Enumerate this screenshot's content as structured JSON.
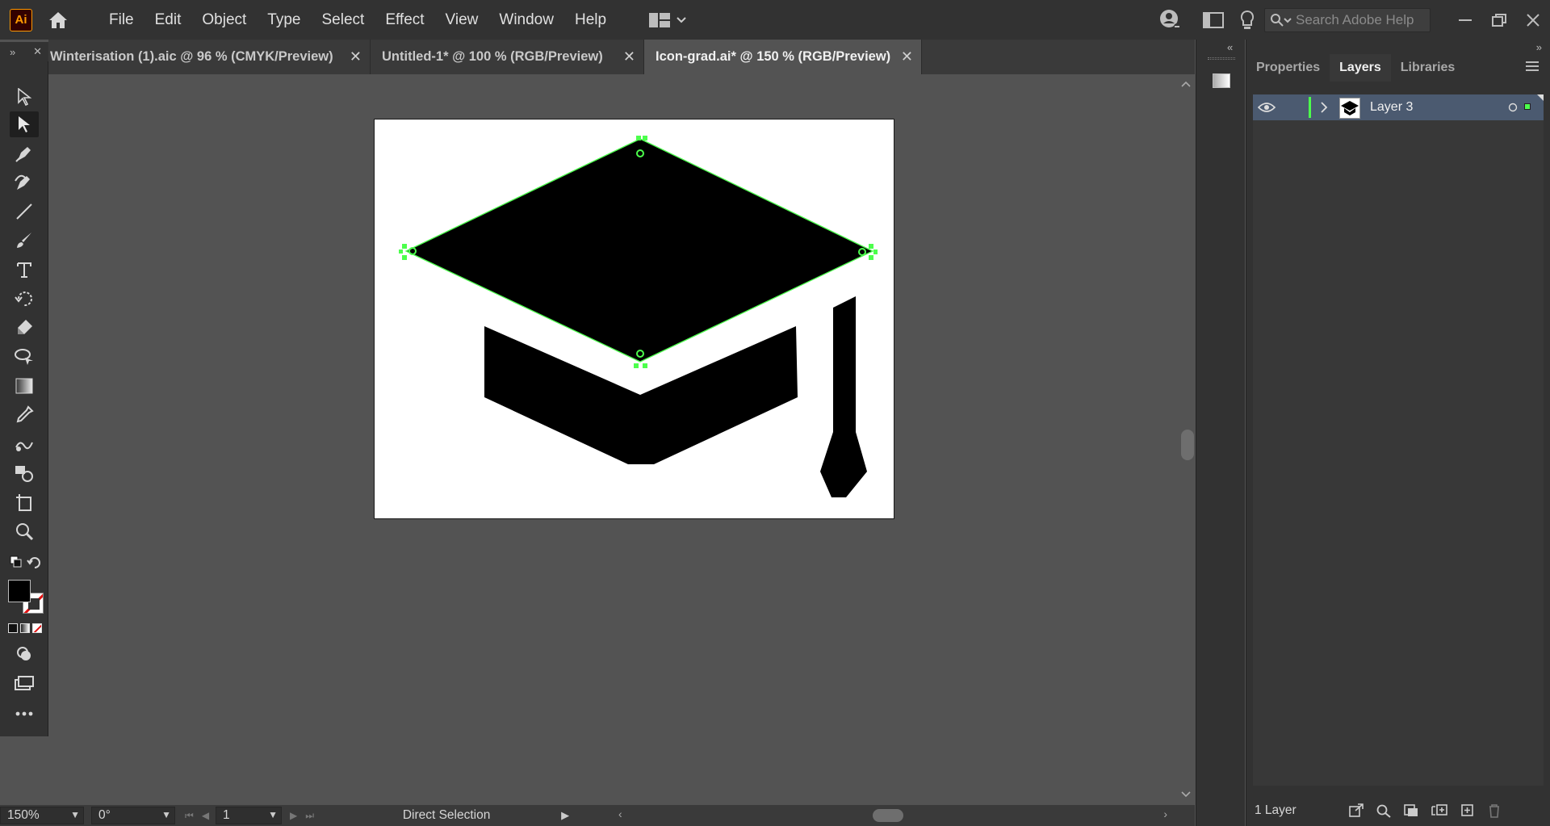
{
  "app": {
    "logo_text": "Ai"
  },
  "menu": [
    "File",
    "Edit",
    "Object",
    "Type",
    "Select",
    "Effect",
    "View",
    "Window",
    "Help"
  ],
  "search": {
    "placeholder": "Search Adobe Help"
  },
  "tabs": [
    {
      "label": "Winterisation (1).aic @ 96 % (CMYK/Preview)",
      "active": false
    },
    {
      "label": "Untitled-1* @ 100 % (RGB/Preview)",
      "active": false
    },
    {
      "label": "Icon-grad.ai* @ 150 % (RGB/Preview)",
      "active": true
    }
  ],
  "close_glyph": "✕",
  "status": {
    "zoom": "150%",
    "rotation": "0°",
    "artboard_number": "1",
    "current_tool": "Direct Selection"
  },
  "panel": {
    "tabs": [
      "Properties",
      "Layers",
      "Libraries"
    ],
    "active_tab": "Layers",
    "layers": [
      {
        "name": "Layer 3",
        "color": "#4cff4c"
      }
    ],
    "layer_count": "1 Layer"
  },
  "colors": {
    "selection": "#4cff4c",
    "fill": "#000000",
    "logo_orange": "#ff9a00"
  },
  "icons": {
    "tools": [
      "selection-tool",
      "direct-selection-tool",
      "pen-tool",
      "curvature-tool",
      "line-tool",
      "paintbrush-tool",
      "type-tool",
      "rotate-tool",
      "eraser-tool",
      "lasso-tool",
      "gradient-tool",
      "eyedropper-tool",
      "blend-tool",
      "shape-builder-tool",
      "artboard-tool",
      "zoom-tool"
    ]
  }
}
